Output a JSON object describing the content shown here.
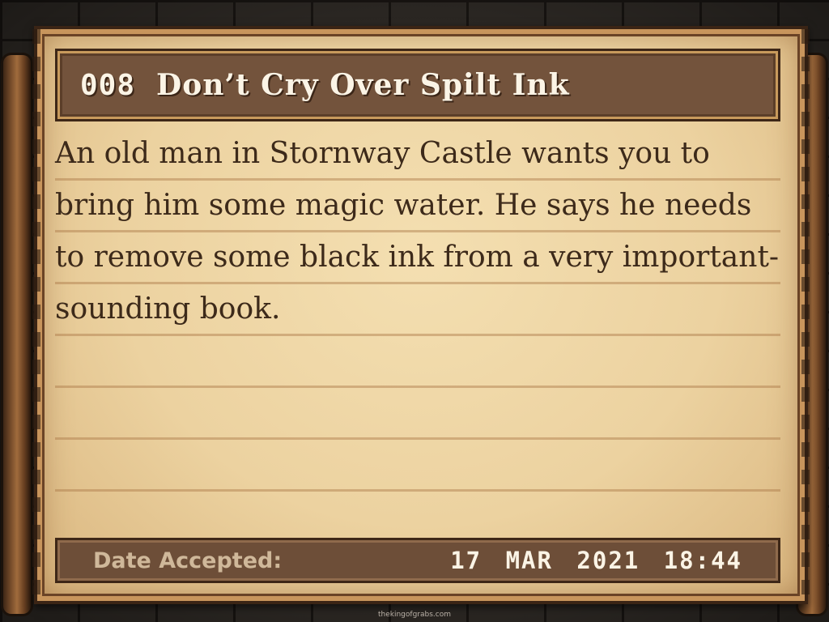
{
  "quest": {
    "number": "008",
    "title": "Don’t Cry Over Spilt Ink",
    "description": "An old man in Stornway Castle wants you to bring him some magic water. He says he needs to remove some black ink from a very important-sounding book."
  },
  "date_bar": {
    "label": "Date Accepted:",
    "value": "17 MAR 2021 18:44"
  },
  "watermark": "thekingofgrabs.com",
  "colors": {
    "parchment": "#ecd2a0",
    "title_bar": "#73533c",
    "date_bar": "#6d4e38",
    "ink": "#3d2a1a"
  }
}
